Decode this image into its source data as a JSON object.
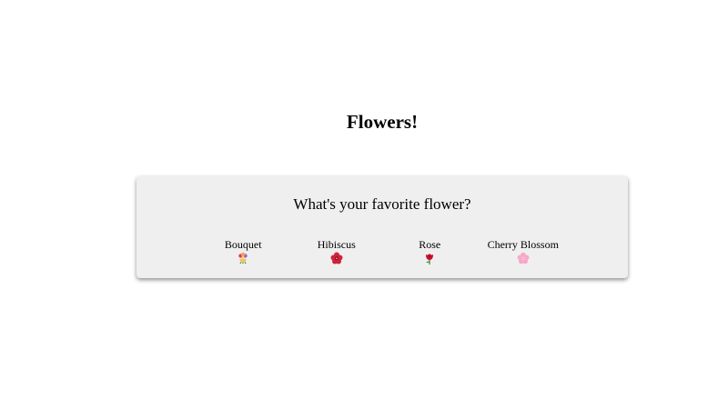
{
  "page": {
    "title": "Flowers!"
  },
  "poll": {
    "question": "What's your favorite flower?",
    "options": [
      {
        "label": "Bouquet",
        "icon": "bouquet-icon"
      },
      {
        "label": "Hibiscus",
        "icon": "hibiscus-icon"
      },
      {
        "label": "Rose",
        "icon": "rose-icon"
      },
      {
        "label": "Cherry Blossom",
        "icon": "cherry-blossom-icon"
      }
    ]
  },
  "colors": {
    "card_background": "#efefef",
    "rose_red": "#c8102e",
    "hibiscus_red": "#d1223e",
    "cherry_pink": "#f7a8c8",
    "leaf_green": "#3a8f2a"
  }
}
